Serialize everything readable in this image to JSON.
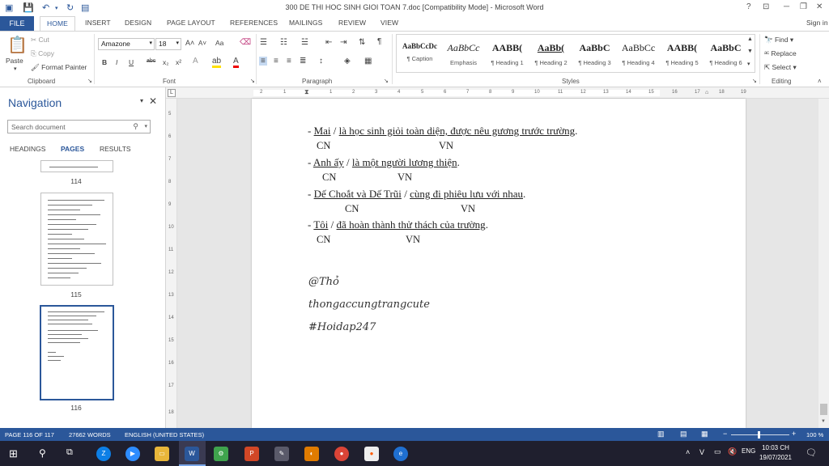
{
  "window": {
    "title": "300 DE THI HOC SINH GIOI TOAN 7.doc [Compatibility Mode] - Microsoft Word",
    "help": "?",
    "sign_in": "Sign in"
  },
  "tabs": [
    "FILE",
    "HOME",
    "INSERT",
    "DESIGN",
    "PAGE LAYOUT",
    "REFERENCES",
    "MAILINGS",
    "REVIEW",
    "VIEW"
  ],
  "ribbon": {
    "clipboard": {
      "label": "Clipboard",
      "paste": "Paste",
      "cut": "Cut",
      "copy": "Copy",
      "format_painter": "Format Painter"
    },
    "font": {
      "label": "Font",
      "font_name": "Amazone",
      "font_size": "18",
      "bold": "B",
      "italic": "I",
      "underline": "U",
      "strike": "abc",
      "sub": "x₂",
      "sup": "x²",
      "grow": "A˄",
      "shrink": "A˅",
      "case": "Aa"
    },
    "paragraph": {
      "label": "Paragraph"
    },
    "styles": {
      "label": "Styles",
      "items": [
        {
          "preview": "AaBbCcDc",
          "name": "¶ Caption"
        },
        {
          "preview": "AaBbCc",
          "name": "Emphasis"
        },
        {
          "preview": "AABB(",
          "name": "¶ Heading 1"
        },
        {
          "preview": "AaBb(",
          "name": "¶ Heading 2"
        },
        {
          "preview": "AaBbC",
          "name": "¶ Heading 3"
        },
        {
          "preview": "AaBbCc",
          "name": "¶ Heading 4"
        },
        {
          "preview": "AABB(",
          "name": "¶ Heading 5"
        },
        {
          "preview": "AaBbC",
          "name": "¶ Heading 6"
        }
      ]
    },
    "editing": {
      "label": "Editing",
      "find": "Find",
      "replace": "Replace",
      "select": "Select"
    }
  },
  "nav": {
    "title": "Navigation",
    "search_placeholder": "Search document",
    "tabs": [
      "HEADINGS",
      "PAGES",
      "RESULTS"
    ],
    "pages": [
      "114",
      "115",
      "116"
    ]
  },
  "ruler": {
    "top": [
      "2",
      "1",
      "",
      "1",
      "2",
      "3",
      "4",
      "5",
      "6",
      "7",
      "8",
      "9",
      "10",
      "11",
      "12",
      "13",
      "14",
      "15",
      "16",
      "17",
      "18",
      "19"
    ],
    "left": [
      "5",
      "6",
      "7",
      "8",
      "9",
      "10",
      "11",
      "12",
      "13",
      "14",
      "15",
      "16",
      "17",
      "18"
    ]
  },
  "document": {
    "lines": [
      {
        "dash": "- ",
        "subject": "Mai",
        "sep": " / ",
        "predicate": "là học sinh giỏi toàn diện, được nêu gương trước trường",
        "end": "."
      },
      {
        "dash": "- ",
        "subject": "Anh ấy",
        "sep": " / ",
        "predicate": "là một người lương thiện",
        "end": "."
      },
      {
        "dash": "- ",
        "subject": "Dế Choắt và Dế Trũi",
        "sep": " / ",
        "predicate": "cùng đi phiêu lưu với nhau",
        "end": "."
      },
      {
        "dash": "- ",
        "subject": "Tôi",
        "sep": " / ",
        "predicate": "đã hoàn thành thử thách của trường",
        "end": "."
      }
    ],
    "label_cn": "CN",
    "label_vn": "VN",
    "signature": [
      "@Thỏ",
      "thongaccungtrangcute",
      "#Hoidap247"
    ]
  },
  "status": {
    "page": "PAGE 116 OF 117",
    "words": "27662 WORDS",
    "language": "ENGLISH (UNITED STATES)",
    "zoom": "100 %"
  },
  "taskbar": {
    "time": "10:03 CH",
    "date": "19/07/2021"
  },
  "colors": {
    "accent": "#2b579a",
    "taskbar": "#1f1f2e"
  }
}
